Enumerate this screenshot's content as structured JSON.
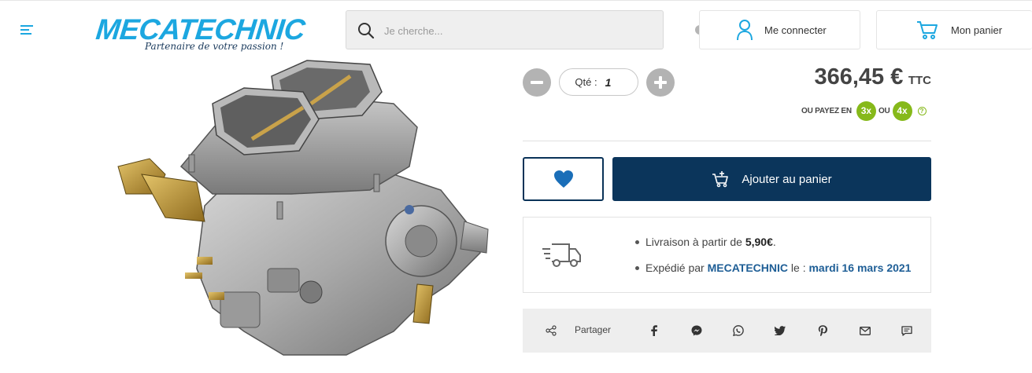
{
  "header": {
    "logo_text": "MECATECHNIC",
    "logo_tagline": "Partenaire de votre passion !",
    "search_placeholder": "Je cherche...",
    "login_label": "Me connecter",
    "cart_label": "Mon panier"
  },
  "product": {
    "qty_label": "Qté :",
    "qty_value": "1",
    "price": "366,45 €",
    "price_suffix": "TTC",
    "pay_prefix": "OU PAYEZ EN",
    "pay_option_1": "3x",
    "pay_or": "OU",
    "pay_option_2": "4x",
    "help_symbol": "?",
    "add_to_cart": "Ajouter au panier"
  },
  "shipping": {
    "line1_text": "Livraison à partir de ",
    "line1_price": "5,90€",
    "line1_end": ".",
    "line2_text": "Expédié par ",
    "line2_seller": "MECATECHNIC",
    "line2_mid": " le : ",
    "line2_date": "mardi 16 mars 2021"
  },
  "share": {
    "label": "Partager",
    "networks": [
      "facebook-icon",
      "messenger-icon",
      "whatsapp-icon",
      "twitter-icon",
      "pinterest-icon",
      "email-icon",
      "sms-icon"
    ]
  },
  "colors": {
    "brand_blue": "#1ca7e0",
    "navy": "#0b355b",
    "pay_green": "#86b91a",
    "link_blue": "#1e5e96"
  }
}
